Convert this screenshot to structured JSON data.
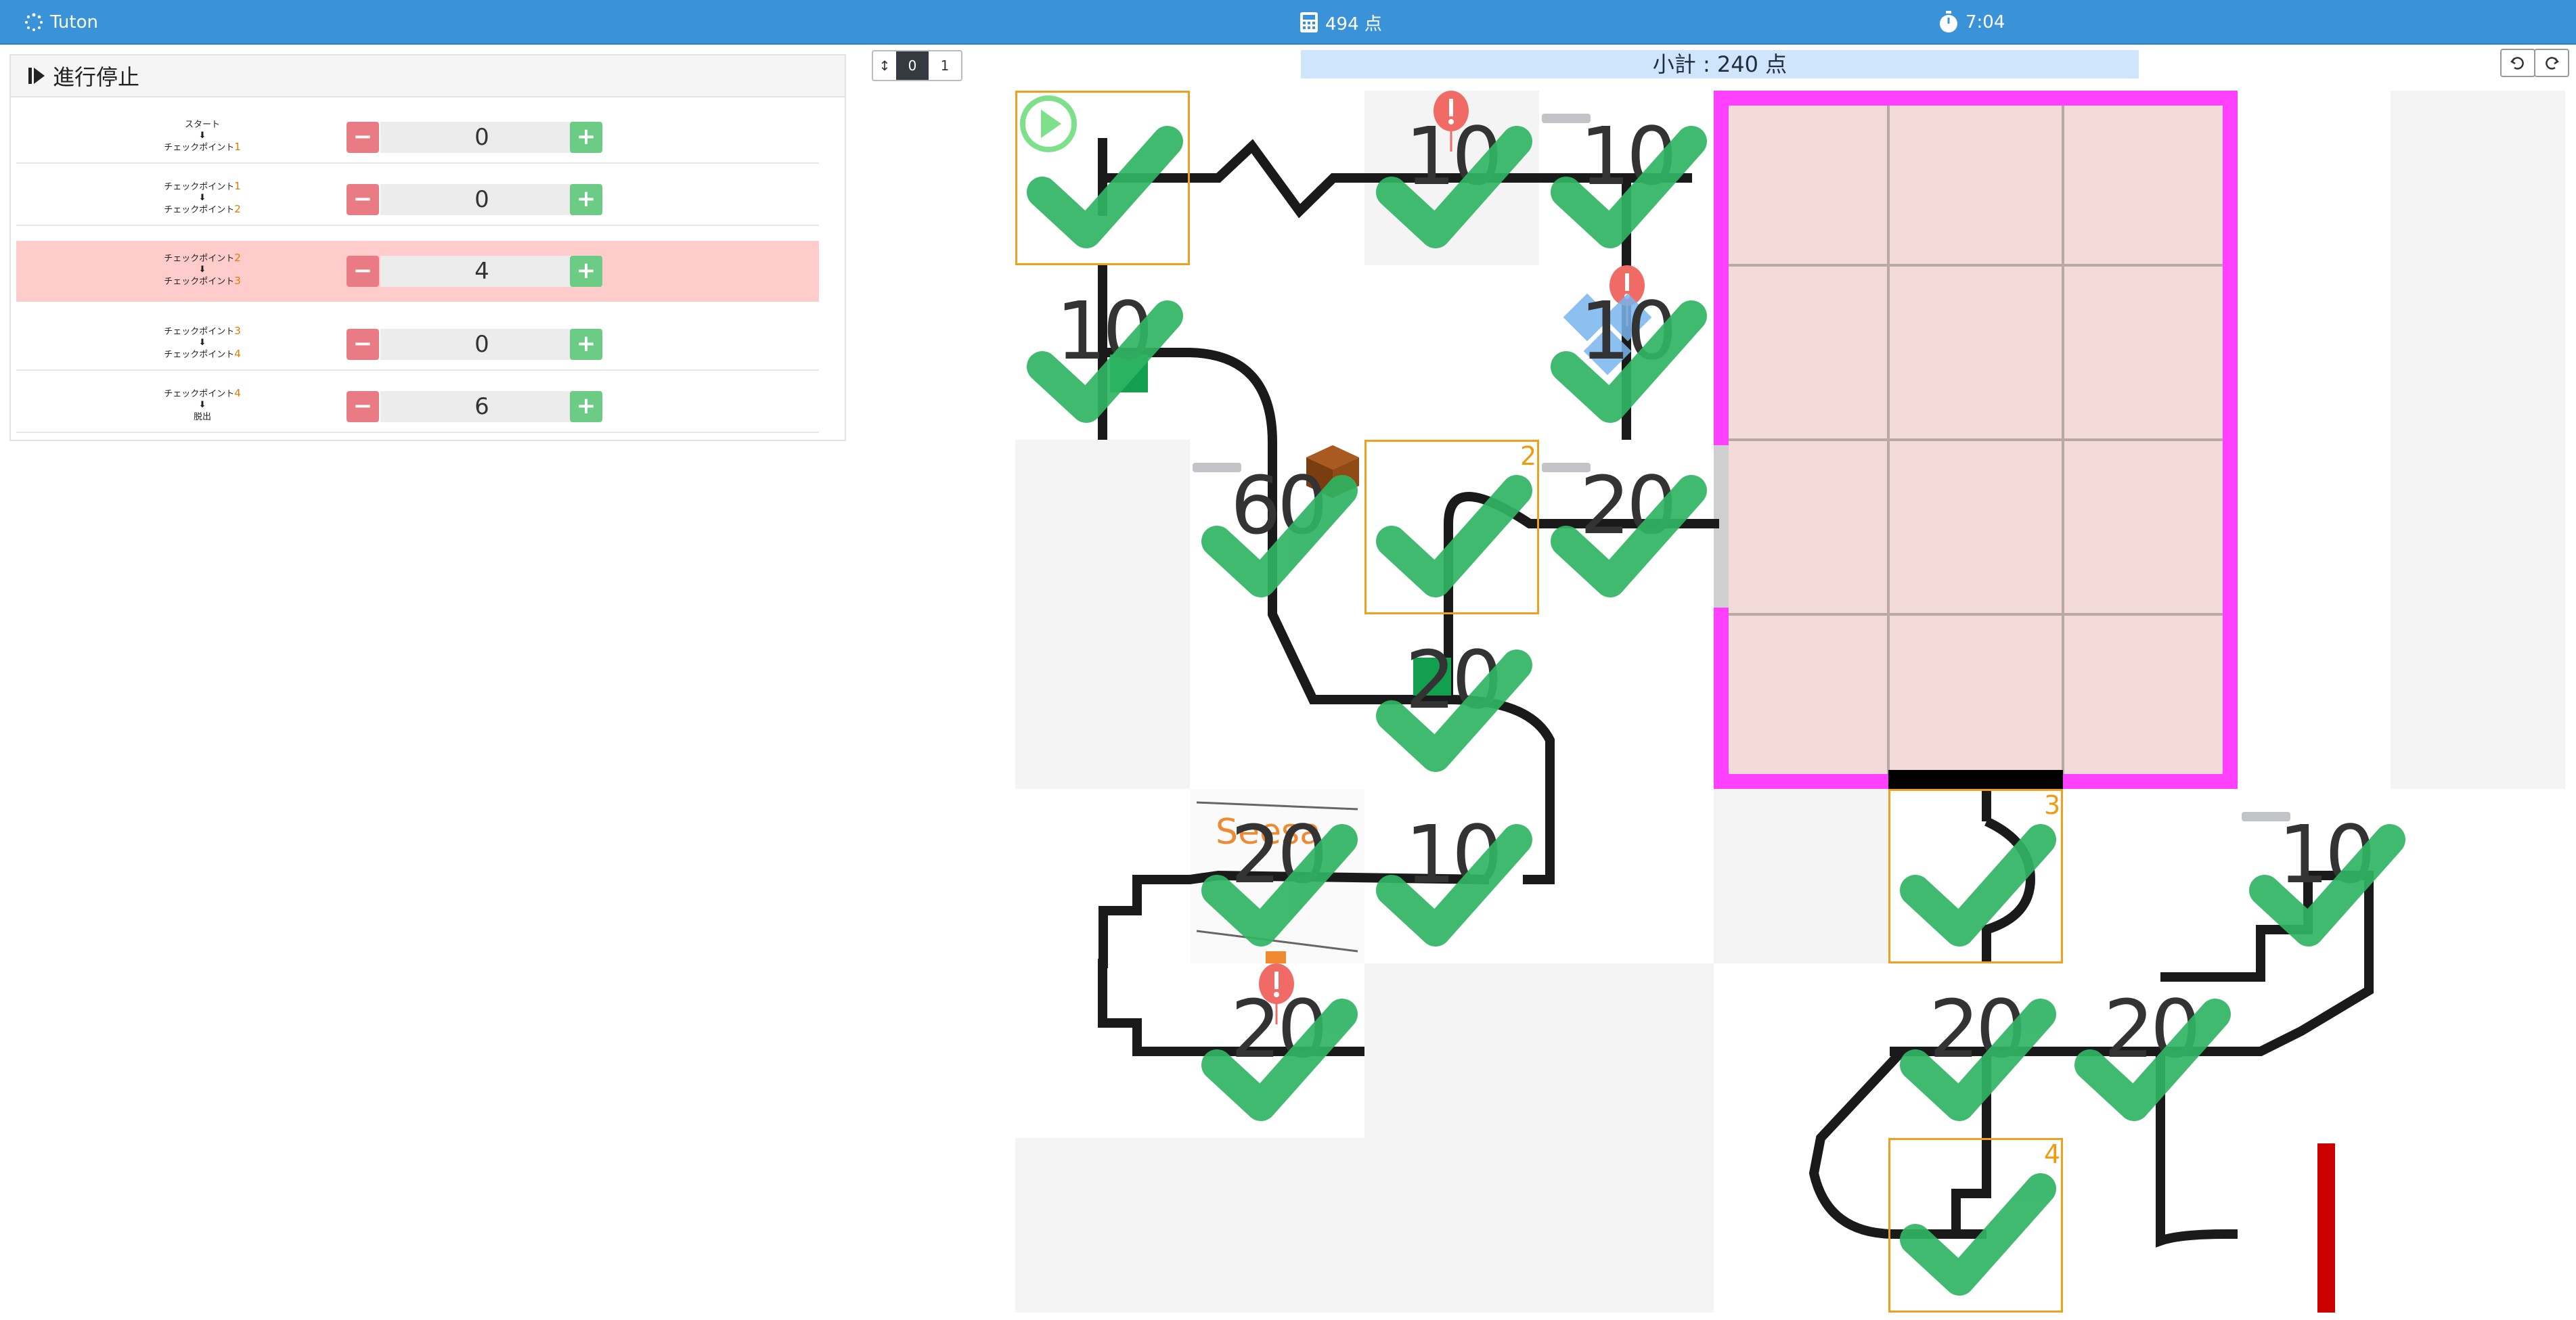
{
  "topbar": {
    "app_name": "Tuton",
    "total_points": "494 点",
    "timer": "7:04",
    "color": "#3a93d8"
  },
  "panel": {
    "title": "進行停止",
    "segments": [
      {
        "from_prefix": "スタート",
        "from_num": "",
        "to_prefix": "チェックポイント",
        "to_num": "1",
        "count": "0",
        "active": false
      },
      {
        "from_prefix": "チェックポイント",
        "from_num": "1",
        "to_prefix": "チェックポイント",
        "to_num": "2",
        "count": "0",
        "active": false
      },
      {
        "from_prefix": "チェックポイント",
        "from_num": "2",
        "to_prefix": "チェックポイント",
        "to_num": "3",
        "count": "4",
        "active": true
      },
      {
        "from_prefix": "チェックポイント",
        "from_num": "3",
        "to_prefix": "チェックポイント",
        "to_num": "4",
        "count": "0",
        "active": false
      },
      {
        "from_prefix": "チェックポイント",
        "from_num": "4",
        "to_prefix": "脱出",
        "to_num": "",
        "count": "6",
        "active": false
      }
    ],
    "minus_label": "−",
    "plus_label": "+"
  },
  "toggle": {
    "icon": "↕",
    "options": [
      "0",
      "1"
    ],
    "selected": "0"
  },
  "subtotal": "小計 : 240 点",
  "undo_icon": "undo-icon",
  "redo_icon": "redo-icon",
  "board": {
    "scores": [
      "10",
      "10",
      "10",
      "10",
      "60",
      "20",
      "20",
      "20",
      "20",
      "10",
      "10",
      "20",
      "20"
    ],
    "checkpoints": [
      "2",
      "3",
      "4"
    ],
    "seesaw_label": "Seesa",
    "accent_pink": "#ff40ff",
    "check_green": "#2fb463",
    "barrier_red": "#cc0000"
  }
}
